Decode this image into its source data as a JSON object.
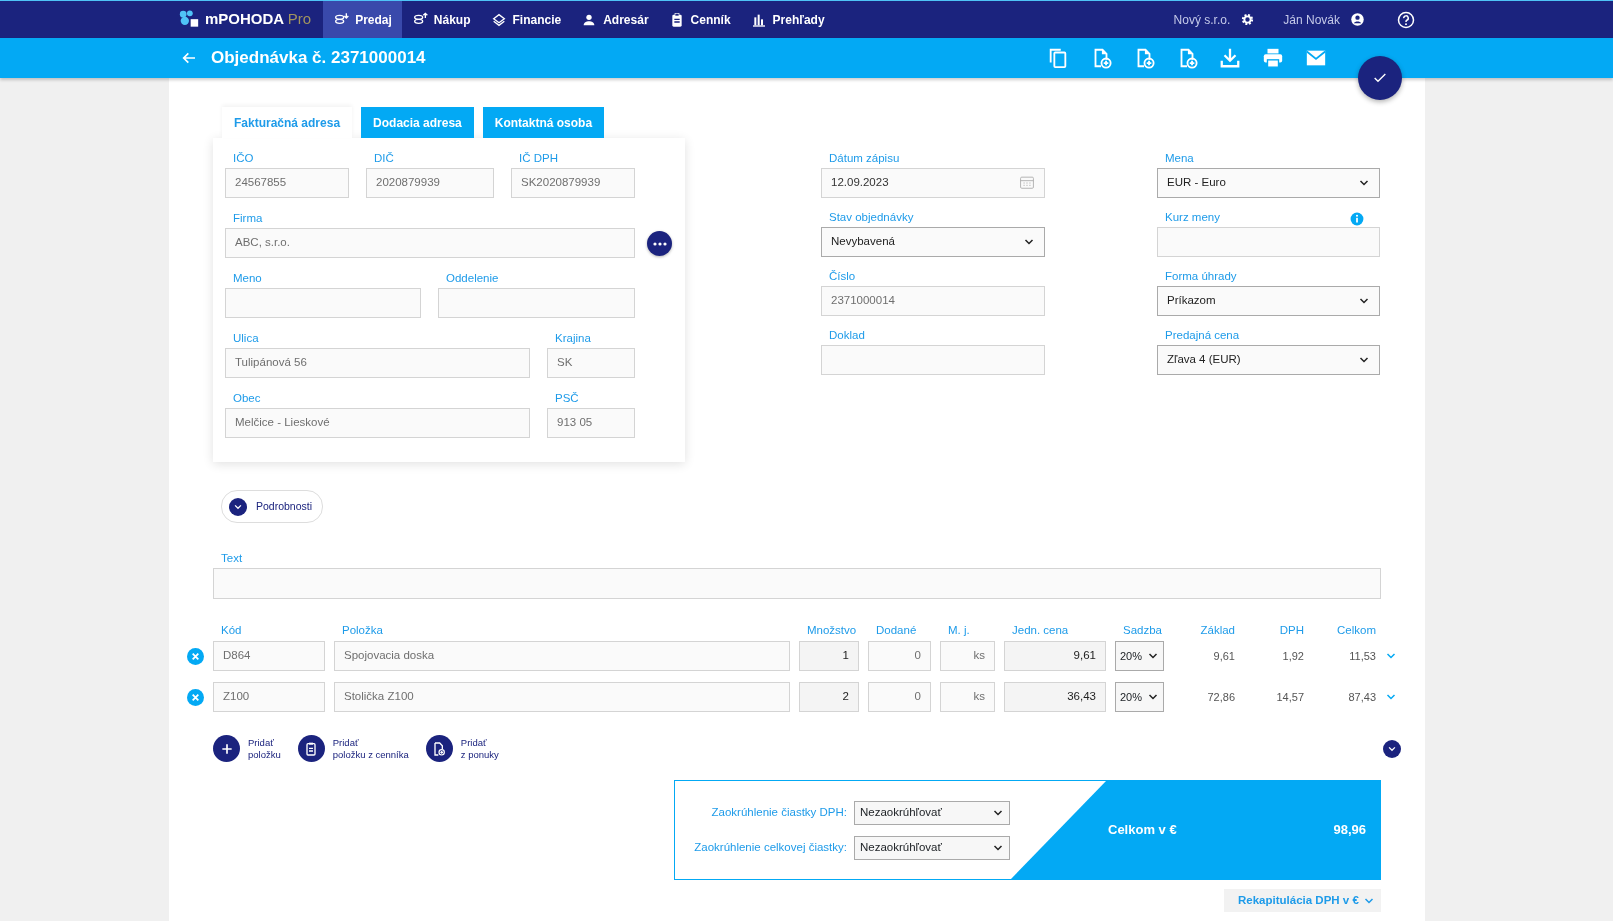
{
  "app": {
    "logo_main": "mPOHODA",
    "logo_suffix": "Pro"
  },
  "nav": [
    {
      "label": "Predaj",
      "kind": "sales",
      "selected": true
    },
    {
      "label": "Nákup",
      "kind": "purchase",
      "selected": false
    },
    {
      "label": "Financie",
      "kind": "finance",
      "selected": false
    },
    {
      "label": "Adresár",
      "kind": "person",
      "selected": false
    },
    {
      "label": "Cenník",
      "kind": "clipboard",
      "selected": false
    },
    {
      "label": "Prehľady",
      "kind": "chart",
      "selected": false
    }
  ],
  "company": "Nový s.r.o.",
  "user": "Ján Novák",
  "header": {
    "title": "Objednávka č. 2371000014"
  },
  "address_tabs": [
    {
      "label": "Fakturačná adresa",
      "selected": true
    },
    {
      "label": "Dodacia adresa",
      "selected": false
    },
    {
      "label": "Kontaktná osoba",
      "selected": false
    }
  ],
  "address_fields": [
    {
      "label": "IČO",
      "value": "24567855"
    },
    {
      "label": "DIČ",
      "value": "2020879939"
    },
    {
      "label": "IČ DPH",
      "value": "SK2020879939"
    },
    {
      "label": "Firma",
      "value": "ABC, s.r.o."
    },
    {
      "label": "Meno"
    },
    {
      "label": "Oddelenie"
    },
    {
      "label": "Ulica",
      "value": "Tulipánová 56"
    },
    {
      "label": "Krajina",
      "value": "SK"
    },
    {
      "label": "Obec",
      "value": "Melčice - Lieskové"
    },
    {
      "label": "PSČ",
      "value": "913 05"
    }
  ],
  "details": [
    {
      "label": "Dátum zápisu",
      "value": "12.09.2023",
      "kind": "date"
    },
    {
      "label": "Mena",
      "value": "EUR - Euro",
      "kind": "select"
    },
    {
      "label": "Stav objednávky",
      "value": "Nevybavená",
      "kind": "select"
    },
    {
      "label": "Kurz meny",
      "kind": "info"
    },
    {
      "label": "Číslo",
      "value": "2371000014",
      "kind": "readonly"
    },
    {
      "label": "Forma úhrady",
      "value": "Príkazom",
      "kind": "select"
    },
    {
      "label": "Doklad",
      "kind": "input"
    },
    {
      "label": "Predajná cena",
      "value": "Zľava 4 (EUR)",
      "kind": "select"
    }
  ],
  "details_toggle": {
    "label": "Podrobnosti",
    "expanded": false
  },
  "text_field": {
    "label": "Text"
  },
  "items": {
    "columns": [
      "Kód",
      "Položka",
      "Množstvo",
      "Dodané",
      "M. j.",
      "Jedn. cena",
      "Sadzba",
      "Základ",
      "DPH",
      "Celkom"
    ],
    "rows": [
      {
        "code": "D864",
        "item": "Spojovacia doska",
        "quantity": "1",
        "delivered": "0",
        "unit": "ks",
        "unit_price": "9,61",
        "rate": "20%",
        "base": "9,61",
        "vat": "1,92",
        "total": "11,53"
      },
      {
        "code": "Z100",
        "item": "Stolička Z100",
        "quantity": "2",
        "delivered": "0",
        "unit": "ks",
        "unit_price": "36,43",
        "rate": "20%",
        "base": "72,86",
        "vat": "14,57",
        "total": "87,43"
      }
    ]
  },
  "add_actions": [
    {
      "lines": [
        "Pridať",
        "položku"
      ],
      "kind": "plus"
    },
    {
      "lines": [
        "Pridať",
        "položku z cenníka"
      ],
      "kind": "clipboard"
    },
    {
      "lines": [
        "Pridať",
        "z ponuky"
      ],
      "kind": "document"
    }
  ],
  "rounding": [
    {
      "label": "Zaokrúhlenie čiastky DPH:",
      "value": "Nezaokrúhľovať"
    },
    {
      "label": "Zaokrúhlenie celkovej čiastky:",
      "value": "Nezaokrúhľovať"
    }
  ],
  "total": {
    "label": "Celkom v €",
    "value": "98,96"
  },
  "recap_button": "Rekapitulácia DPH v €"
}
